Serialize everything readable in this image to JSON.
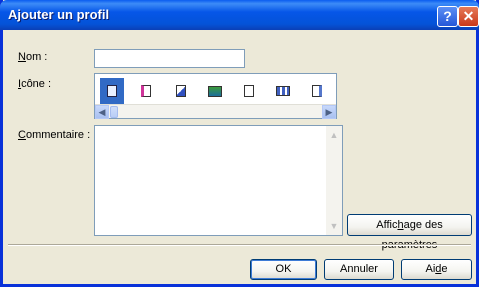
{
  "window": {
    "title": "Ajouter un profil"
  },
  "titlebar": {
    "help_glyph": "?",
    "close_glyph": "✕"
  },
  "form": {
    "name_label_u": "N",
    "name_label_rest": "om :",
    "name_value": "",
    "icon_label_u": "I",
    "icon_label_rest": "cône :",
    "comment_label_u": "C",
    "comment_label_rest": "ommentaire :",
    "comment_value": "",
    "icons": [
      "document-icon",
      "pink-document-icon",
      "arrow-document-icon",
      "image-document-icon",
      "page-icon",
      "list-view-icon",
      "edit-document-icon"
    ],
    "selected_icon_index": 0
  },
  "buttons": {
    "settings_pre": "Affic",
    "settings_u": "h",
    "settings_post": "age des paramètres",
    "ok": "OK",
    "cancel": "Annuler",
    "help_pre": "Ai",
    "help_u": "d",
    "help_post": "e"
  },
  "scroll": {
    "left": "◀",
    "right": "▶",
    "up": "▲",
    "down": "▼"
  }
}
